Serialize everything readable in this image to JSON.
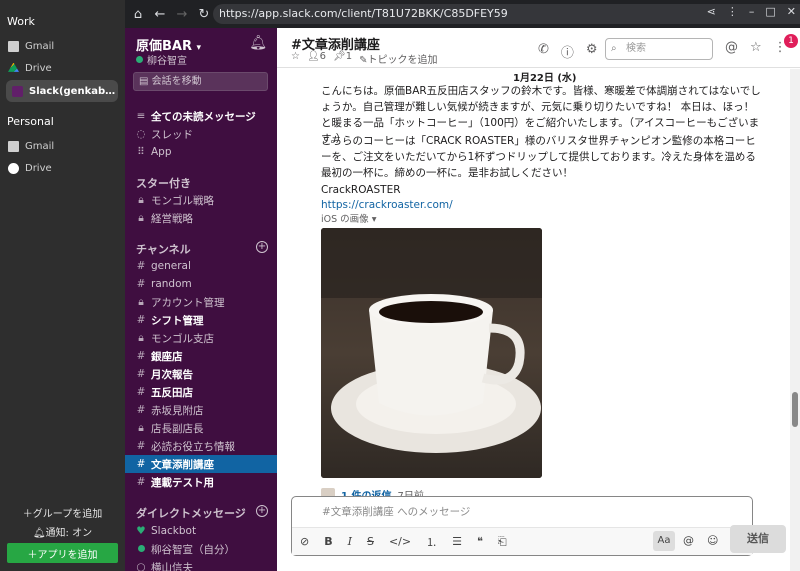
{
  "outer_sidebar": {
    "work_label": "Work",
    "work_items": [
      {
        "label": "Gmail",
        "icon": "mail-icon"
      },
      {
        "label": "Drive",
        "icon": "drive-icon"
      },
      {
        "label": "Slack(genkab…",
        "icon": "slack-icon"
      }
    ],
    "personal_label": "Personal",
    "personal_items": [
      {
        "label": "Gmail",
        "icon": "mail-icon"
      },
      {
        "label": "Drive",
        "icon": "google-icon"
      }
    ],
    "add_group": "＋グループを追加",
    "notify": "通知: オン",
    "add_app": "＋アプリを追加"
  },
  "browser": {
    "url": "https://app.slack.com/client/T81U72BKK/C85DFEY59"
  },
  "workspace": {
    "team_name": "原価BAR",
    "user_name": "柳谷智宣",
    "jump_placeholder": "会話を移動",
    "top_items": [
      "全ての未読メッセージ",
      "スレッド",
      "App"
    ],
    "starred_label": "スター付き",
    "starred": [
      "モンゴル戦略",
      "経営戦略"
    ],
    "channels_label": "チャンネル",
    "channels": [
      {
        "prefix": "#",
        "label": "general",
        "bold": false
      },
      {
        "prefix": "#",
        "label": "random",
        "bold": false
      },
      {
        "prefix": "lock",
        "label": "アカウント管理",
        "bold": false
      },
      {
        "prefix": "#",
        "label": "シフト管理",
        "bold": true
      },
      {
        "prefix": "lock",
        "label": "モンゴル支店",
        "bold": false
      },
      {
        "prefix": "#",
        "label": "銀座店",
        "bold": true
      },
      {
        "prefix": "#",
        "label": "月次報告",
        "bold": true
      },
      {
        "prefix": "#",
        "label": "五反田店",
        "bold": true
      },
      {
        "prefix": "#",
        "label": "赤坂見附店",
        "bold": false
      },
      {
        "prefix": "lock",
        "label": "店長副店長",
        "bold": false
      },
      {
        "prefix": "#",
        "label": "必読お役立ち情報",
        "bold": false
      },
      {
        "prefix": "#",
        "label": "文章添削講座",
        "bold": true,
        "selected": true
      },
      {
        "prefix": "#",
        "label": "連載テスト用",
        "bold": true
      }
    ],
    "dm_label": "ダイレクトメッセージ",
    "dms": [
      "Slackbot",
      "柳谷智宣（自分）",
      "横山信夫"
    ]
  },
  "channel": {
    "title": "#文章添削講座",
    "members": "6",
    "pins": "1",
    "topic": "トピックを追加",
    "search_placeholder": "検索",
    "mentions_badge": "1"
  },
  "message": {
    "date": "1月22日 (水)",
    "para1": "こんにちは。原価BAR五反田店スタッフの鈴木です。皆様、寒暖差で体調崩されてはないでしょうか。自己管理が難しい気候が続きますが、元気に乗り切りたいですね！ 本日は、ほっ！ と暖まる一品「ホットコーヒー」（100円）をご紹介いたします。（アイスコーヒーもございます。）",
    "para2": "こちらのコーヒーは「CRACK ROASTER」様のバリスタ世界チャンピオン監修の本格コーヒーを、ご注文をいただいてから1杯ずつドリップして提供しております。冷えた身体を温める最初の一杯に。締めの一杯に。是非お試しください！",
    "link_name": "CrackROASTER",
    "link_url": "https://crackroaster.com/",
    "image_label": "iOS の画像",
    "reply_count": "1 件の返信",
    "reply_when": "7日前"
  },
  "composer": {
    "placeholder": "#文章添削講座 へのメッセージ",
    "aa": "Aa",
    "send": "送信"
  },
  "colors": {
    "workspace_bg": "#3f0e40",
    "selected": "#1164a3",
    "online": "#2bac76",
    "badge": "#e01e5a",
    "link": "#1264a3"
  }
}
